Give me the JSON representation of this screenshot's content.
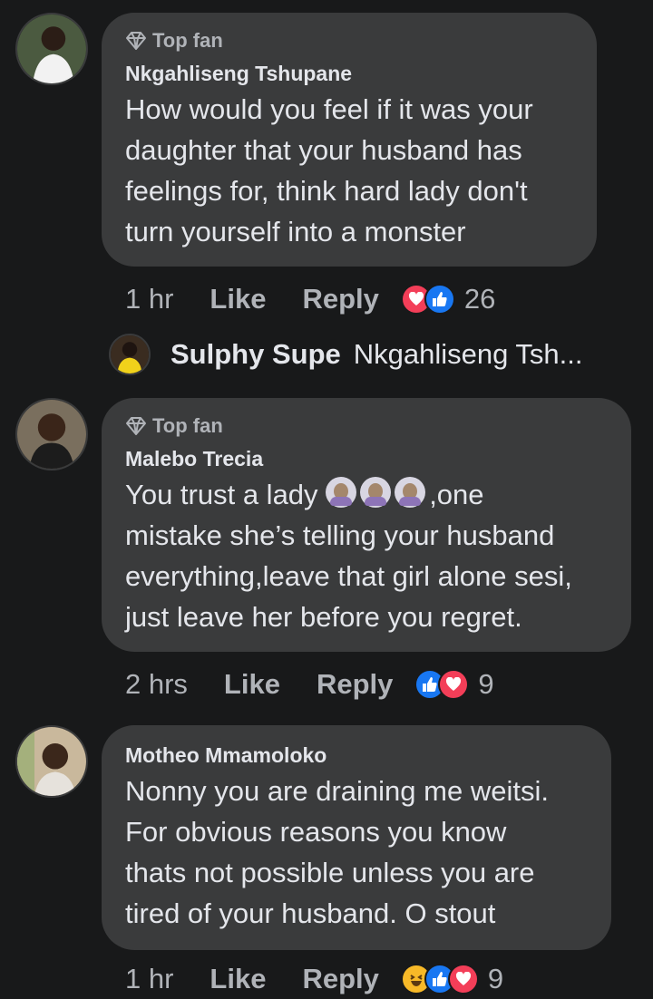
{
  "comments": [
    {
      "badge": "Top fan",
      "author": "Nkgahliseng Tshupane",
      "lines": [
        "How would you feel if it was your",
        "daughter that  your husband has",
        "feelings for, think hard lady don't",
        "turn yourself into a monster"
      ],
      "time": "1 hr",
      "like_label": "Like",
      "reply_label": "Reply",
      "reaction_count": "26",
      "reactions": [
        "love",
        "like"
      ]
    },
    {
      "badge": "Top fan",
      "author": "Malebo Trecia",
      "lines": [
        "You trust a lady",
        ",one",
        "mistake she’s telling your husband",
        "everything,leave that girl alone sesi,",
        "just leave her before you regret."
      ],
      "time": "2 hrs",
      "like_label": "Like",
      "reply_label": "Reply",
      "reaction_count": "9",
      "reactions": [
        "like",
        "love"
      ]
    },
    {
      "author": "Motheo Mmamoloko",
      "lines": [
        "Nonny you are draining me weitsi.",
        "For obvious reasons you know",
        "thats not possible unless you are",
        "tired of your husband. O stout"
      ],
      "time": "1 hr",
      "like_label": "Like",
      "reply_label": "Reply",
      "reaction_count": "9",
      "reactions": [
        "haha",
        "like",
        "love"
      ]
    }
  ],
  "reply_preview": {
    "author": "Sulphy Supe",
    "snippet": "Nkgahliseng Tsh..."
  },
  "colors": {
    "background": "#18191a",
    "bubble": "#3a3b3c",
    "text": "#e4e6eb",
    "secondary": "#b0b3b8",
    "like_blue": "#1877f2",
    "love_red": "#f33e58",
    "haha_yellow": "#f7b928"
  }
}
